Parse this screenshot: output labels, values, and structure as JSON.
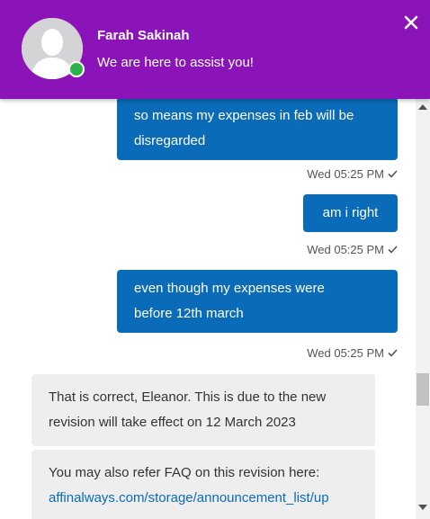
{
  "header": {
    "agent_name": "Farah Sakinah",
    "agent_status": "We are here to assist you!",
    "accent_color": "#8a14b8",
    "online_color": "#2fb24a"
  },
  "messages": [
    {
      "direction": "outgoing",
      "lines": [
        "so means my expenses in feb will be",
        "disregarded"
      ],
      "time": "Wed 05:25 PM"
    },
    {
      "direction": "outgoing",
      "lines": [
        "am i right"
      ],
      "time": "Wed 05:25 PM"
    },
    {
      "direction": "outgoing",
      "lines": [
        "even though my expenses were",
        "before 12th march"
      ],
      "time": "Wed 05:25 PM"
    },
    {
      "direction": "incoming",
      "lines": [
        "That is correct, Eleanor. This is due to the new",
        "revision will take effect on 12 March 2023"
      ]
    },
    {
      "direction": "incoming",
      "lines": [
        "You may also refer FAQ on this revision here:"
      ],
      "link": "affinalways.com/storage/announcement_list/up"
    }
  ],
  "colors": {
    "outgoing_bubble": "#0a6bb8",
    "incoming_bubble": "#eeeeee"
  },
  "icons": {
    "close": "close-icon",
    "read_receipt": "checkmark-icon",
    "avatar": "user-silhouette-icon"
  }
}
